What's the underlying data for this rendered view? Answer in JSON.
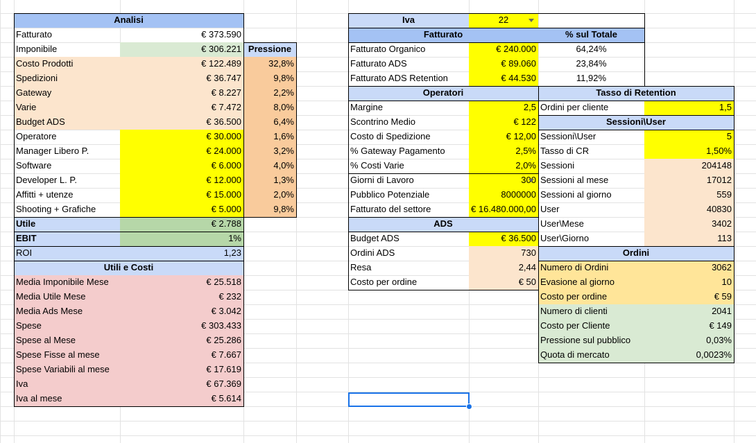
{
  "colors": {
    "header_blue": "#a4c2f4",
    "light_blue": "#c9daf8",
    "yellow": "#ffff00",
    "peach": "#fce5cd",
    "orange": "#f9cb9c",
    "green": "#b6d7a8",
    "light_green": "#d9ead3",
    "pink": "#f4cccc",
    "gold": "#ffe599",
    "gridline": "#e2e2e2",
    "selection": "#1a73e8"
  },
  "analisi": {
    "title": "Analisi",
    "pressione_header": "Pressione",
    "rows": [
      {
        "label": "Fatturato",
        "value": "€ 373.590",
        "pressione": ""
      },
      {
        "label": "Imponibile",
        "value": "€ 306.221",
        "pressione": ""
      },
      {
        "label": "Costo Prodotti",
        "value": "€ 122.489",
        "pressione": "32,8%"
      },
      {
        "label": "Spedizioni",
        "value": "€ 36.747",
        "pressione": "9,8%"
      },
      {
        "label": "Gateway",
        "value": "€ 8.227",
        "pressione": "2,2%"
      },
      {
        "label": "Varie",
        "value": "€ 7.472",
        "pressione": "8,0%"
      },
      {
        "label": "Budget ADS",
        "value": "€ 36.500",
        "pressione": "6,4%"
      },
      {
        "label": "Operatore",
        "value": "€ 30.000",
        "pressione": "1,6%"
      },
      {
        "label": "Manager Libero P.",
        "value": "€ 24.000",
        "pressione": "3,2%"
      },
      {
        "label": "Software",
        "value": "€ 6.000",
        "pressione": "4,0%"
      },
      {
        "label": "Developer L. P.",
        "value": "€ 12.000",
        "pressione": "1,3%"
      },
      {
        "label": "Affitti + utenze",
        "value": "€ 15.000",
        "pressione": "2,0%"
      },
      {
        "label": "Shooting + Grafiche",
        "value": "€ 5.000",
        "pressione": "9,8%"
      },
      {
        "label": "Utile",
        "value": "€ 2.788",
        "pressione": ""
      },
      {
        "label": "EBIT",
        "value": "1%",
        "pressione": ""
      },
      {
        "label": "ROI",
        "value": "1,23",
        "pressione": ""
      }
    ]
  },
  "utili_costi": {
    "title": "Utili e Costi",
    "rows": [
      {
        "label": "Media Imponibile Mese",
        "value": "€ 25.518"
      },
      {
        "label": "Media Utile Mese",
        "value": "€ 232"
      },
      {
        "label": "Media Ads Mese",
        "value": "€ 3.042"
      },
      {
        "label": "Spese",
        "value": "€ 303.433"
      },
      {
        "label": "Spese al Mese",
        "value": "€ 25.286"
      },
      {
        "label": "Spese Fisse al mese",
        "value": "€ 7.667"
      },
      {
        "label": "Spese Variabili al mese",
        "value": "€ 17.619"
      },
      {
        "label": "Iva",
        "value": "€ 67.369"
      },
      {
        "label": "Iva al mese",
        "value": "€ 5.614"
      }
    ]
  },
  "iva": {
    "label": "Iva",
    "value": "22"
  },
  "fatturato": {
    "title": "Fatturato",
    "totale_header": "% sul Totale",
    "rows": [
      {
        "label": "Fatturato Organico",
        "value": "€ 240.000",
        "pct": "64,24%"
      },
      {
        "label": "Fatturato ADS",
        "value": "€ 89.060",
        "pct": "23,84%"
      },
      {
        "label": "Fatturato ADS Retention",
        "value": "€ 44.530",
        "pct": "11,92%"
      }
    ]
  },
  "operatori": {
    "title": "Operatori",
    "rows": [
      {
        "label": "Margine",
        "value": "2,5"
      },
      {
        "label": "Scontrino Medio",
        "value": "€ 122"
      },
      {
        "label": "Costo di Spedizione",
        "value": "€ 12,00"
      },
      {
        "label": "% Gateway Pagamento",
        "value": "2,5%"
      },
      {
        "label": "% Costi Varie",
        "value": "2,0%"
      },
      {
        "label": "Giorni di Lavoro",
        "value": "300"
      },
      {
        "label": "Pubblico Potenziale",
        "value": "8000000"
      },
      {
        "label": "Fatturato del settore",
        "value": "€ 16.480.000,00"
      }
    ]
  },
  "ads": {
    "title": "ADS",
    "rows": [
      {
        "label": "Budget ADS",
        "value": "€ 36.500"
      },
      {
        "label": "Ordini ADS",
        "value": "730"
      },
      {
        "label": "Resa",
        "value": "2,44"
      },
      {
        "label": "Costo per ordine",
        "value": "€ 50"
      }
    ]
  },
  "retention": {
    "title": "Tasso di Retention",
    "rows": [
      {
        "label": "Ordini per cliente",
        "value": "1,5"
      }
    ]
  },
  "sessioni": {
    "title": "Sessioni\\User",
    "rows": [
      {
        "label": "Sessioni\\User",
        "value": "5"
      },
      {
        "label": "Tasso di CR",
        "value": "1,50%"
      },
      {
        "label": "Sessioni",
        "value": "204148"
      },
      {
        "label": "Sessioni al mese",
        "value": "17012"
      },
      {
        "label": "Sessioni al giorno",
        "value": "559"
      },
      {
        "label": "User",
        "value": "40830"
      },
      {
        "label": "User\\Mese",
        "value": "3402"
      },
      {
        "label": "User\\Giorno",
        "value": "113"
      }
    ]
  },
  "ordini": {
    "title": "Ordini",
    "rows": [
      {
        "label": "Numero di Ordini",
        "value": "3062"
      },
      {
        "label": "Evasione al giorno",
        "value": "10"
      },
      {
        "label": "Costo per ordine",
        "value": "€ 59"
      },
      {
        "label": "Numero di clienti",
        "value": "2041"
      },
      {
        "label": "Costo per Cliente",
        "value": "€ 149"
      },
      {
        "label": "Pressione sul pubblico",
        "value": "0,03%"
      },
      {
        "label": "Quota di mercato",
        "value": "0,0023%"
      }
    ]
  }
}
